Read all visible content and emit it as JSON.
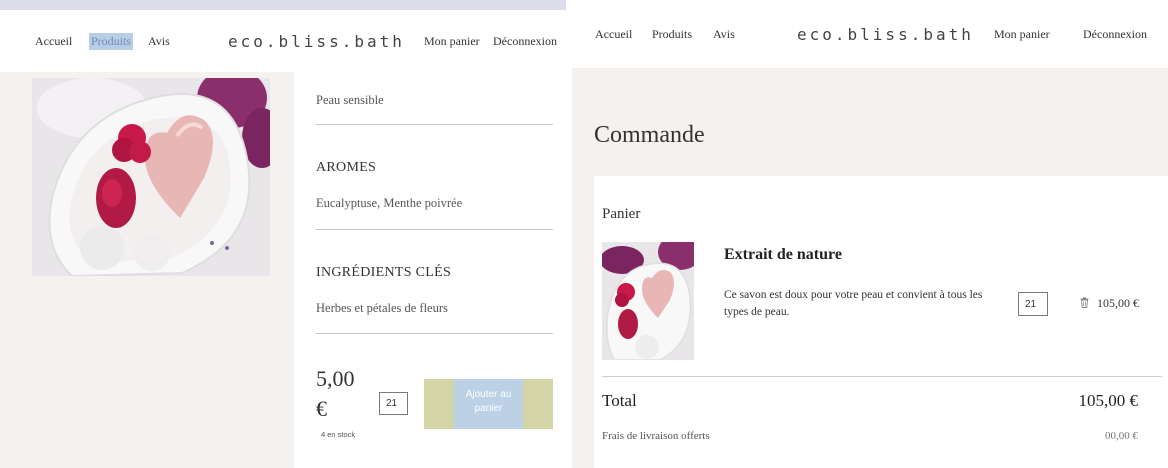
{
  "left": {
    "nav": {
      "accueil": "Accueil",
      "produits": "Produits",
      "avis": "Avis",
      "logo": "eco.bliss.bath",
      "panier": "Mon panier",
      "deconnexion": "Déconnexion"
    },
    "details": {
      "skin_value": "Peau sensible",
      "aromes_heading": "AROMES",
      "aromes_value": "Eucalyptuse, Menthe poivrée",
      "ingredients_heading": "INGRÉDIENTS CLÉS",
      "ingredients_value": "Herbes et pétales de fleurs",
      "price_amount": "5,00",
      "price_currency": "€",
      "stock": "4 en stock",
      "quantity": "21",
      "add_to_cart": "Ajouter au panier"
    }
  },
  "right": {
    "nav": {
      "accueil": "Accueil",
      "produits": "Produits",
      "avis": "Avis",
      "logo": "eco.bliss.bath",
      "panier": "Mon panier",
      "deconnexion": "Déconnexion"
    },
    "title": "Commande",
    "cart": {
      "heading": "Panier",
      "item": {
        "name": "Extrait de nature",
        "description": "Ce savon est doux pour votre peau et convient à tous les types de peau.",
        "quantity": "21",
        "price": "105,00 €"
      },
      "total_label": "Total",
      "total_value": "105,00 €",
      "shipping_label": "Frais de livraison offerts",
      "shipping_value": "00,00 €"
    }
  },
  "colors": {
    "page_bg": "#f4f1ee",
    "highlight": "#b8cde6",
    "button_blue": "#bcd0e6",
    "button_band": "#d3d5a6"
  },
  "icons": {
    "trash": "trash-icon"
  }
}
